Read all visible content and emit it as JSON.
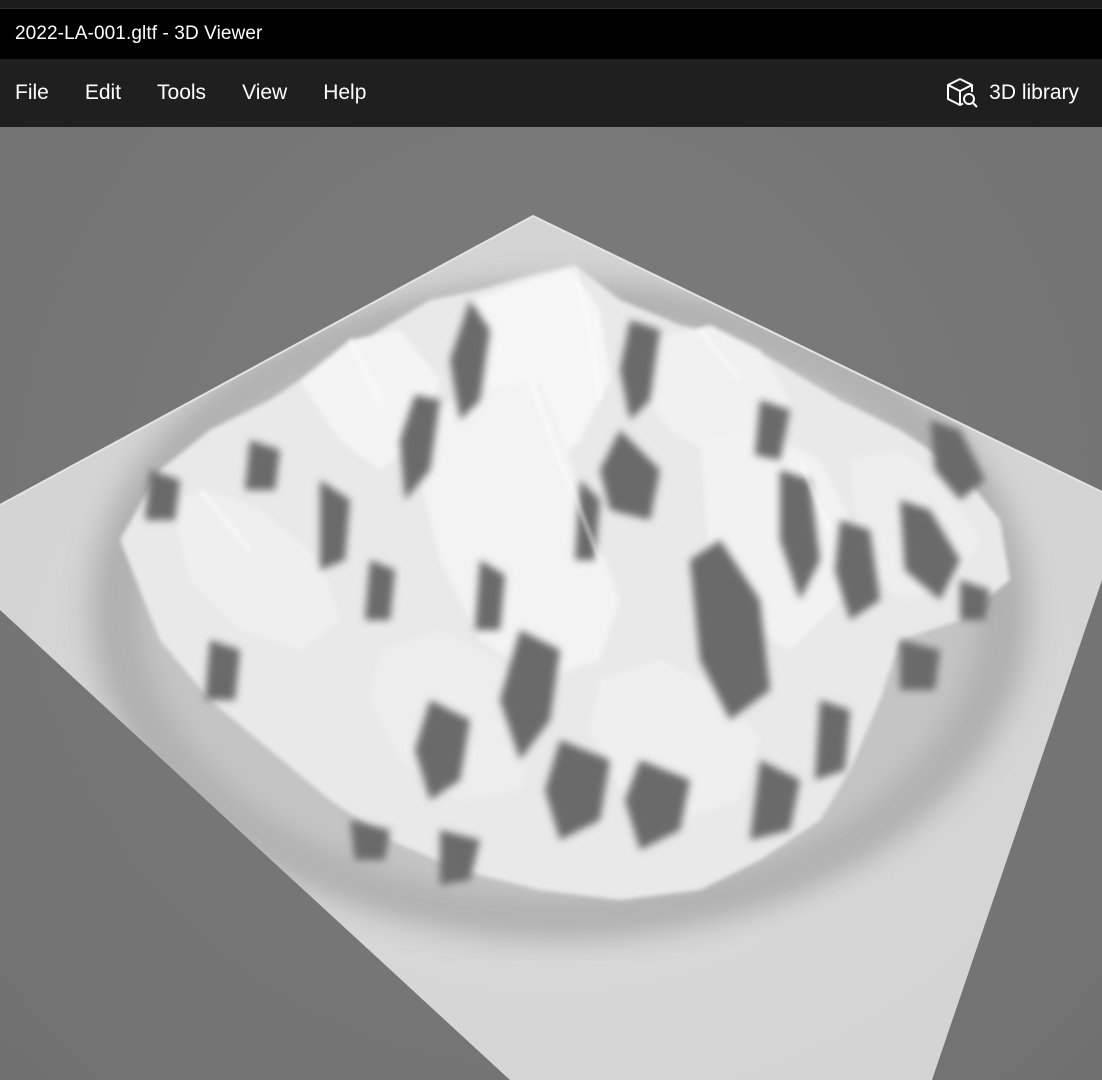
{
  "window": {
    "title": "2022-LA-001.gltf - 3D Viewer"
  },
  "menu": {
    "items": [
      "File",
      "Edit",
      "Tools",
      "View",
      "Help"
    ]
  },
  "library": {
    "label": "3D library",
    "icon": "3d-library-icon"
  },
  "viewport": {
    "model": "terrain-mesh",
    "background_color": "#777777",
    "surface_color": "#e6e6e6",
    "shadow_color": "#6a6a6a"
  }
}
